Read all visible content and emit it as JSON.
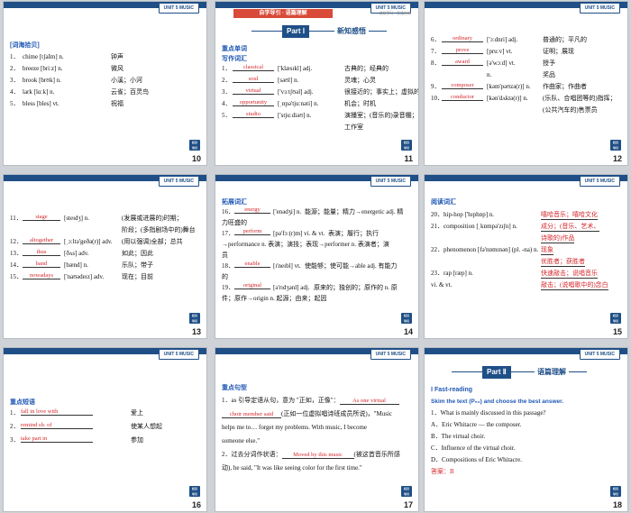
{
  "unit_tag": "UNIT 5   MUSIC",
  "corner_label": "栏目\n导引",
  "s10": {
    "page": "10",
    "heading": "[词海拾贝]",
    "items": [
      {
        "n": "1．",
        "t": "chime [tʃaIm] n.",
        "m": "钟声"
      },
      {
        "n": "2．",
        "t": "breeze [briːz] n.",
        "m": "微风"
      },
      {
        "n": "3．",
        "t": "brook [brʊk] n.",
        "m": "小溪；小河"
      },
      {
        "n": "4．",
        "t": "lark [lɑːk] n.",
        "m": "云雀；百灵鸟"
      },
      {
        "n": "5．",
        "t": "bless [bles] vt.",
        "m": "祝福"
      }
    ]
  },
  "s11": {
    "page": "11",
    "strip": "自学导引 · 语篇理解",
    "note": "课前预习 · 思维检测",
    "part_no": "Part Ⅰ",
    "part_title": "新知感悟",
    "h1": "重点单词",
    "h2": "写作词汇",
    "items": [
      {
        "n": "1．",
        "ans": "classical",
        "t": "['klæsɪkl] adj.",
        "m": "古典的；经典的"
      },
      {
        "n": "2．",
        "ans": "soul",
        "t": "[səʊl] n.",
        "m": "灵魂；心灵"
      },
      {
        "n": "3．",
        "ans": "virtual",
        "t": "['vɜːtʃʊəl] adj.",
        "m": "很接近的；事实上；虚拟的"
      },
      {
        "n": "4．",
        "ans": "opportunity",
        "t": "[ˌɒpə'tjuːnəti] n.",
        "m": "机会；时机"
      },
      {
        "n": "5．",
        "ans": "studio",
        "t": "['stjuːdiəʊ] n.",
        "m": "演播室；(音乐的)录音棚；"
      }
    ],
    "cont": "工作室"
  },
  "s12": {
    "page": "12",
    "items": [
      {
        "n": "6．",
        "ans": "ordinary",
        "t": "['ɔːdnri] adj.",
        "m": "普通的；平凡的"
      },
      {
        "n": "7．",
        "ans": "prove",
        "t": "[pruːv] vt.",
        "m": "证明；展现"
      },
      {
        "n": "8．",
        "ans": "award",
        "t": "[ə'wɔːd] vt.",
        "m": "授予"
      },
      {
        "n": "",
        "ans": "",
        "t": "n.",
        "m": "奖品"
      },
      {
        "n": "9．",
        "ans": "composer",
        "t": "[kəm'pəʊzə(r)] n.",
        "m": "作曲家；作曲者"
      },
      {
        "n": "10．",
        "ans": "conductor",
        "t": "[kən'dʌktə(r)] n.",
        "m": "(乐队、合唱团等的)指挥；"
      }
    ],
    "cont": "(公共汽车的)售票员"
  },
  "s13": {
    "page": "13",
    "items": [
      {
        "n": "11．",
        "ans": "stage",
        "t": "[steɪdʒ] n.",
        "m": "(发展或进展的)时期；"
      },
      {
        "n": "",
        "ans": "",
        "t": "",
        "m": "阶段；(多指剧场中的)舞台"
      },
      {
        "n": "12．",
        "ans": "altogether",
        "t": "[ˌɔːltə'geðə(r)] adv.",
        "m": "(用以强调)全部；总共"
      },
      {
        "n": "13．",
        "ans": "thus",
        "t": "[ðʌs] adv.",
        "m": "如此；因此"
      },
      {
        "n": "14．",
        "ans": "band",
        "t": "[bænd] n.",
        "m": "乐队；带子"
      },
      {
        "n": "15．",
        "ans": "nowadays",
        "t": "['naʊədeɪz] adv.",
        "m": "现在；目前"
      }
    ]
  },
  "s14": {
    "page": "14",
    "heading": "拓展词汇",
    "items": [
      {
        "n": "16．",
        "ans": "energy",
        "t": "['enədʒi] n.",
        "m": "能源；能量；精力→energetic adj.  精"
      },
      {
        "n": "",
        "ans": "",
        "t": "",
        "m": "力旺盛的"
      },
      {
        "n": "17．",
        "ans": "perform",
        "t": "[pə'fɔː(r)m] vi. & vt.",
        "m": "表演；履行；执行"
      },
      {
        "n": "",
        "ans": "",
        "t": "",
        "m": "→performance n.  表演；演技；表现→performer n.  表演者；演"
      },
      {
        "n": "",
        "ans": "",
        "t": "",
        "m": "员"
      },
      {
        "n": "18．",
        "ans": "enable",
        "t": "[ɪ'neɪbl] vt.",
        "m": "使能够；使可能→able adj.  有能力"
      },
      {
        "n": "",
        "ans": "",
        "t": "",
        "m": "的"
      },
      {
        "n": "19．",
        "ans": "original",
        "t": "[ə'rɪdʒənl] adj.",
        "m": "原来的；独创的；原作的  n.  原"
      },
      {
        "n": "",
        "ans": "",
        "t": "",
        "m": "件；原作→origin n.  起源；由来；起因"
      }
    ]
  },
  "s15": {
    "page": "15",
    "heading": "阅读词汇",
    "items": [
      {
        "n": "20．",
        "t": "hip-hop ['hɪphɒp] n.",
        "m": "嘻哈音乐；嘻哈文化"
      },
      {
        "n": "21．",
        "t": "composition [ˌkɒmpə'zɪʃn] n.",
        "m": "成分；(音乐、艺术、"
      },
      {
        "n": "",
        "t": "",
        "m": "诗歌的)作品"
      },
      {
        "n": "22．",
        "t": "phenomenon [fə'nɒmɪnən] (pl.  -na) n.",
        "m": "现象"
      },
      {
        "n": "",
        "t": "",
        "m": "优胜者；获胜者"
      },
      {
        "n": "23．",
        "t": "rap [ræp] n.",
        "m": "快速敲击；说唱音乐"
      },
      {
        "n": "",
        "t": "vi.  & vt.",
        "m": "敲击；(说唱歌中的)念白"
      }
    ]
  },
  "s16": {
    "page": "16",
    "heading": "重点短语",
    "items": [
      {
        "n": "1．",
        "ans": "fall in love with",
        "m": "爱上"
      },
      {
        "n": "2．",
        "ans": "remind sb.  of",
        "m": "使某人想起"
      },
      {
        "n": "3．",
        "ans": "take part in",
        "m": "参加"
      }
    ]
  },
  "s17": {
    "page": "17",
    "heading": "重点句型",
    "p1_a": "1．as 引导定语从句，意为 \"正如，正像\"：",
    "p1_ans": "As one virtual",
    "p1_ans2": "choir member said",
    "p1_b": "(正如一位虚拟唱诗班成员所说)，\"Music",
    "p1_c": "helps me to…  forget my problems.  With music, I become",
    "p1_d": "someone else.\"",
    "p2_a": "2．过去分词作状语：",
    "p2_ans": "Moved by this music",
    "p2_b": "(被这首音乐所感",
    "p2_c": "动), he said, \"It was like seeing color for the first time.\""
  },
  "s18": {
    "page": "18",
    "part_no": "Part Ⅱ",
    "part_title": "语篇理解",
    "fast": "Ⅰ  Fast-reading",
    "instr": "Skim the text (P₅₀) and choose the best answer.",
    "q": "1．What is mainly discussed in this passage?",
    "opts": [
      "A．Eric Whitacre — the composer.",
      "B．The virtual choir.",
      "C．Influence of the virtual choir.",
      "D．Compositions of Eric Whitacre."
    ],
    "ans": "答案：B"
  }
}
